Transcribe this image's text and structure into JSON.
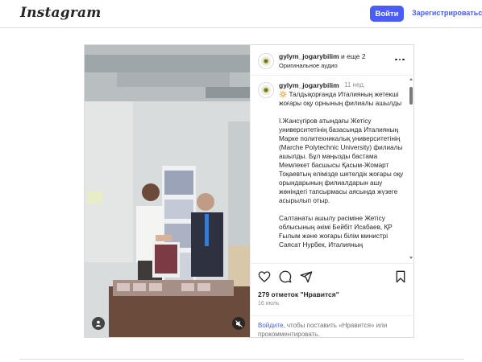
{
  "header": {
    "logo": "Instagram",
    "login_label": "Войти",
    "signup_label": "Зарегистрироваться"
  },
  "post": {
    "author": "gylym_jogarybilim",
    "coauthors": "и еще 2",
    "audio": "Оригинальное аудио",
    "caption_time": "11 нед.",
    "caption_paragraphs": [
      "🔆 Талдықорғанда Италияның жетекші жоғары оқу орнының филиалы ашылды",
      "І.Жансүгіров атындағы Жетісу университетінің базасында Италияның Марке политехникалық университетінің (Marche Polytechnic University) филиалы ашылды. Бұл маңызды бастама Мемлекет басшысы Қасым-Жомарт Тоқаевтың елімізде шетелдік жоғары оқу орындарының филиалдарын ашу жөніндегі тапсырмасы аясында жүзеге асырылып отыр.",
      "Салтанаты ашылу рәсіміне Жетісу облысының әкімі Бейбіт Исабаев, ҚР Ғылым және жоғары білім министрі Саясат Нурбек, Италияның"
    ],
    "likes": "279 отметок \"Нравится\"",
    "date": "16 июль",
    "login_prompt_link": "Войдите",
    "login_prompt_rest": ", чтобы поставить «Нравится» или прокомментировать."
  },
  "icons": {
    "heart": "heart-icon",
    "comment": "comment-icon",
    "share": "share-icon",
    "bookmark": "bookmark-icon",
    "more": "more-options-icon",
    "user_tag": "user-tag-icon",
    "mute": "mute-icon"
  },
  "colors": {
    "accent": "#4a5df9",
    "border": "#dbdbdb",
    "secondary_text": "#8e8e8e"
  }
}
